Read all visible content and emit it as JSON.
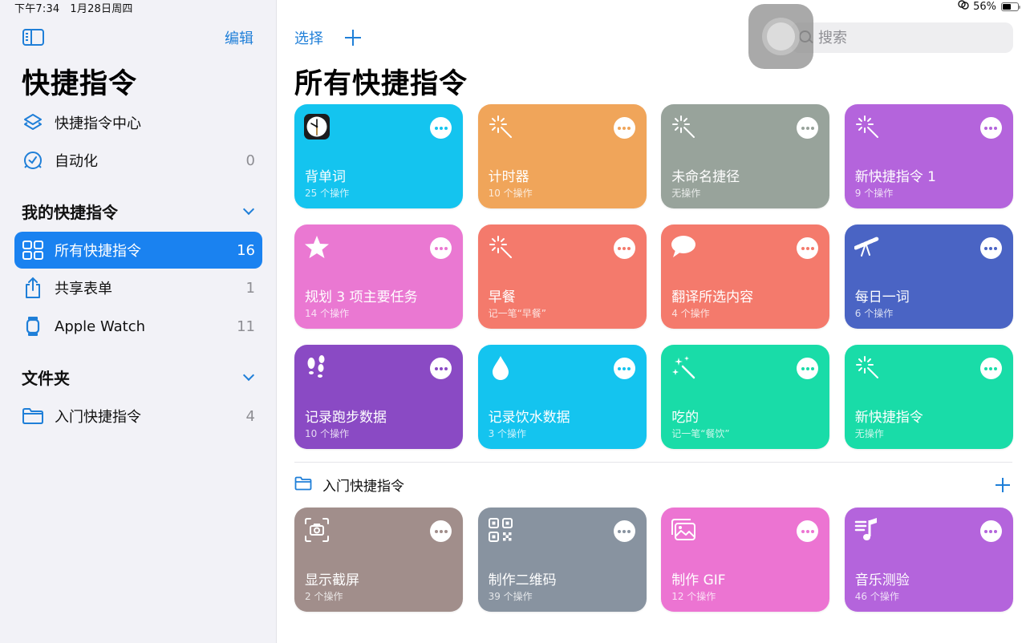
{
  "status_bar": {
    "time": "下午7:34",
    "date": "1月28日周四",
    "battery_percent": "56%",
    "battery_level": 0.56
  },
  "sidebar": {
    "edit_label": "编辑",
    "title": "快捷指令",
    "top_items": [
      {
        "label": "快捷指令中心",
        "icon": "layers-icon",
        "count": ""
      },
      {
        "label": "自动化",
        "icon": "clock-check-icon",
        "count": "0"
      }
    ],
    "my_shortcuts": {
      "title": "我的快捷指令",
      "items": [
        {
          "label": "所有快捷指令",
          "icon": "grid-icon",
          "count": "16",
          "active": true
        },
        {
          "label": "共享表单",
          "icon": "share-icon",
          "count": "1"
        },
        {
          "label": "Apple Watch",
          "icon": "watch-icon",
          "count": "11"
        }
      ]
    },
    "folders": {
      "title": "文件夹",
      "items": [
        {
          "label": "入门快捷指令",
          "icon": "folder-icon",
          "count": "4"
        }
      ]
    }
  },
  "main": {
    "select_label": "选择",
    "add_label": "+",
    "search_placeholder": "搜索",
    "title": "所有快捷指令",
    "shortcuts": [
      {
        "name": "背单词",
        "subtitle": "25 个操作",
        "icon": "clock-app-icon",
        "color": "#14c4ef"
      },
      {
        "name": "计时器",
        "subtitle": "10 个操作",
        "icon": "magic-wand-icon",
        "color": "#f0a55a"
      },
      {
        "name": "未命名捷径",
        "subtitle": "无操作",
        "icon": "magic-wand-icon",
        "color": "#98a39b"
      },
      {
        "name": "新快捷指令 1",
        "subtitle": "9 个操作",
        "icon": "magic-wand-icon",
        "color": "#b464dc"
      },
      {
        "name": "规划 3 项主要任务",
        "subtitle": "14 个操作",
        "icon": "star-icon",
        "color": "#ea78d2"
      },
      {
        "name": "早餐",
        "subtitle": "记一笔“早餐”",
        "icon": "magic-wand-icon",
        "color": "#f47a6c"
      },
      {
        "name": "翻译所选内容",
        "subtitle": "4 个操作",
        "icon": "speech-bubble-icon",
        "color": "#f47a6c"
      },
      {
        "name": "每日一词",
        "subtitle": "6 个操作",
        "icon": "telescope-icon",
        "color": "#4a64c4"
      },
      {
        "name": "记录跑步数据",
        "subtitle": "10 个操作",
        "icon": "footprints-icon",
        "color": "#8a4ac4"
      },
      {
        "name": "记录饮水数据",
        "subtitle": "3 个操作",
        "icon": "water-drop-icon",
        "color": "#14c4ef"
      },
      {
        "name": "吃的",
        "subtitle": "记一笔“餐饮”",
        "icon": "sparkle-wand-icon",
        "color": "#19dca8"
      },
      {
        "name": "新快捷指令",
        "subtitle": "无操作",
        "icon": "magic-wand-icon",
        "color": "#19dca8"
      }
    ],
    "folder_section": {
      "title": "入门快捷指令",
      "add_label": "+",
      "shortcuts": [
        {
          "name": "显示截屏",
          "subtitle": "2 个操作",
          "icon": "screenshot-icon",
          "color": "#a18e8b"
        },
        {
          "name": "制作二维码",
          "subtitle": "39 个操作",
          "icon": "qr-code-icon",
          "color": "#8893a0"
        },
        {
          "name": "制作 GIF",
          "subtitle": "12 个操作",
          "icon": "photos-icon",
          "color": "#ec74d2"
        },
        {
          "name": "音乐测验",
          "subtitle": "46 个操作",
          "icon": "music-list-icon",
          "color": "#b464dc"
        }
      ]
    }
  }
}
